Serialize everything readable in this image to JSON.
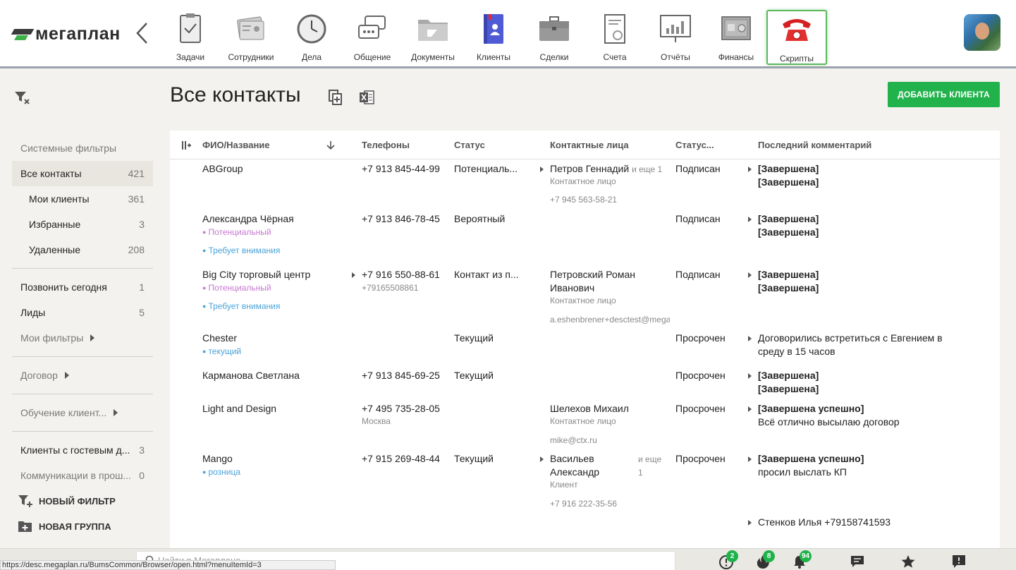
{
  "app": {
    "logo_text": "мегаплан"
  },
  "nav": [
    {
      "label": "Задачи",
      "icon": "tasks-icon"
    },
    {
      "label": "Сотрудники",
      "icon": "employees-icon"
    },
    {
      "label": "Дела",
      "icon": "clock-icon"
    },
    {
      "label": "Общение",
      "icon": "chat-icon"
    },
    {
      "label": "Документы",
      "icon": "folder-icon"
    },
    {
      "label": "Клиенты",
      "icon": "contacts-book-icon"
    },
    {
      "label": "Сделки",
      "icon": "briefcase-icon"
    },
    {
      "label": "Счета",
      "icon": "invoice-icon"
    },
    {
      "label": "Отчёты",
      "icon": "report-chart-icon"
    },
    {
      "label": "Финансы",
      "icon": "safe-icon"
    },
    {
      "label": "Скрипты",
      "icon": "phone-icon",
      "active": true
    }
  ],
  "page": {
    "title": "Все контакты",
    "add_button": "ДОБАВИТЬ КЛИЕНТА"
  },
  "sidebar": {
    "system_filters": "Системные фильтры",
    "items": [
      {
        "label": "Все контакты",
        "count": "421"
      },
      {
        "label": "Мои клиенты",
        "count": "361"
      },
      {
        "label": "Избранные",
        "count": "3"
      },
      {
        "label": "Удаленные",
        "count": "208"
      },
      {
        "label": "Позвонить сегодня",
        "count": "1"
      },
      {
        "label": "Лиды",
        "count": "5"
      },
      {
        "label": "Мои фильтры"
      },
      {
        "label": "Договор"
      },
      {
        "label": "Обучение клиент..."
      },
      {
        "label": "Клиенты с гостевым д...",
        "count": "3"
      },
      {
        "label": "Коммуникации в прош...",
        "count": "0"
      }
    ],
    "new_filter": "НОВЫЙ ФИЛЬТР",
    "new_group": "НОВАЯ ГРУППА"
  },
  "table": {
    "headers": {
      "name": "ФИО/Название",
      "phones": "Телефоны",
      "status": "Статус",
      "contacts": "Контактные лица",
      "status2": "Статус...",
      "comment": "Последний комментарий"
    },
    "rows": [
      {
        "name": "ABGroup",
        "phone": "+7 913 845-44-99",
        "status": "Потенциаль...",
        "contact": "Петров Геннадий",
        "contact_more": "и еще 1",
        "contact_role": "Контактное лицо",
        "contact_info": "+7 945 563-58-21",
        "status2": "Подписан",
        "comment1": "[Завершена]",
        "comment2": "[Завершена]"
      },
      {
        "name": "Александра Чёрная",
        "tag1": "Потенциальный",
        "tag2": "Требует внимания",
        "phone": "+7 913 846-78-45",
        "status": "Вероятный",
        "status2": "Подписан",
        "comment1": "[Завершена]",
        "comment2": "[Завершена]"
      },
      {
        "name": "Big City торговый центр",
        "tag1": "Потенциальный",
        "tag2": "Требует внимания",
        "phone": "+7 916 550-88-61",
        "phone_sub": "+79165508861",
        "status": "Контакт из п...",
        "contact": "Петровский Роман Иванович",
        "contact_role": "Контактное лицо",
        "contact_info": "a.eshenbrener+desctest@mega",
        "status2": "Подписан",
        "comment1": "[Завершена]",
        "comment2": "[Завершена]"
      },
      {
        "name": "Chester",
        "tag1": "текущий",
        "status": "Текущий",
        "status2": "Просрочен",
        "comment1": "Договорились встретиться с Евгением в среду в 15 часов"
      },
      {
        "name": "Карманова Светлана",
        "phone": "+7 913 845-69-25",
        "status": "Текущий",
        "status2": "Просрочен",
        "comment1": "[Завершена]",
        "comment2": "[Завершена]"
      },
      {
        "name": "Light and Design",
        "phone": "+7 495 735-28-05",
        "phone_sub": "Москва",
        "contact": "Шелехов Михаил",
        "contact_role": "Контактное лицо",
        "contact_info": "mike@ctx.ru",
        "status2": "Просрочен",
        "comment1": "[Завершена успешно]",
        "comment2": "Всё отлично высылаю договор"
      },
      {
        "name": "Mango",
        "tag1": "розница",
        "phone": "+7 915 269-48-44",
        "status": "Текущий",
        "contact": "Васильев Александр",
        "contact_more": "и еще 1",
        "contact_role": "Клиент",
        "contact_info": "+7 916 222-35-56",
        "status2": "Просрочен",
        "comment1": "[Завершена успешно]",
        "comment2": "просил выслать КП",
        "comment3": "Стенков Илья +79158741593"
      }
    ]
  },
  "bottom": {
    "search_placeholder": "Найти в Мегаплане",
    "status_url": "https://desc.megaplan.ru/BumsCommon/Browser/open.html?menuItemId=3",
    "badges": {
      "alerts": "2",
      "hot": "8",
      "notifications": "94"
    }
  },
  "colors": {
    "accent": "#22b24c",
    "active_border": "#5cb85c",
    "tag_pink": "#c678d1",
    "tag_blue": "#4aa3d8"
  }
}
